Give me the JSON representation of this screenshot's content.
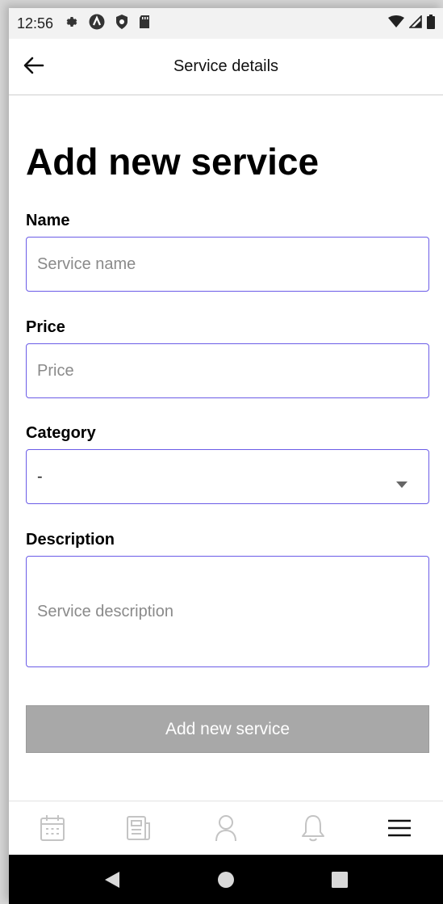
{
  "status_bar": {
    "time": "12:56",
    "icons": [
      "gear-icon",
      "a-circle-icon",
      "shield-icon",
      "sd-card-icon"
    ],
    "right_icons": [
      "wifi-icon",
      "signal-icon",
      "battery-icon"
    ]
  },
  "app_bar": {
    "title": "Service details",
    "back_icon": "arrow-left-icon"
  },
  "form": {
    "heading": "Add new service",
    "name_label": "Name",
    "name_placeholder": "Service name",
    "price_label": "Price",
    "price_placeholder": "Price",
    "category_label": "Category",
    "category_value": "-",
    "description_label": "Description",
    "description_placeholder": "Service description",
    "submit_label": "Add new service"
  },
  "bottom_nav": {
    "items": [
      {
        "icon": "calendar-icon"
      },
      {
        "icon": "newspaper-icon"
      },
      {
        "icon": "person-icon"
      },
      {
        "icon": "bell-icon"
      },
      {
        "icon": "menu-icon"
      }
    ]
  },
  "system_nav": [
    "back-triangle-icon",
    "home-circle-icon",
    "recents-square-icon"
  ],
  "colors": {
    "accent_border": "#6b5ce7",
    "button_disabled": "#a8a8a8",
    "nav_icon_inactive": "#c4c4c4",
    "nav_icon_active": "#111111"
  }
}
